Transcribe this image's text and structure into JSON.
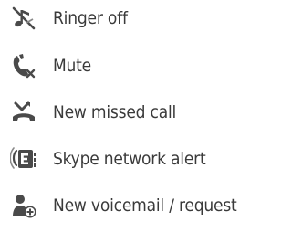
{
  "legend": {
    "items": [
      {
        "icon": "ringer-off-icon",
        "label": "Ringer off"
      },
      {
        "icon": "mute-icon",
        "label": "Mute"
      },
      {
        "icon": "missed-call-icon",
        "label": "New missed call"
      },
      {
        "icon": "network-alert-icon",
        "label": "Skype network alert"
      },
      {
        "icon": "voicemail-request-icon",
        "label": "New voicemail / request"
      }
    ]
  },
  "colors": {
    "icon": "#4a4a4a",
    "icon_light": "#8a8a8a",
    "text": "#3a3a3a"
  }
}
